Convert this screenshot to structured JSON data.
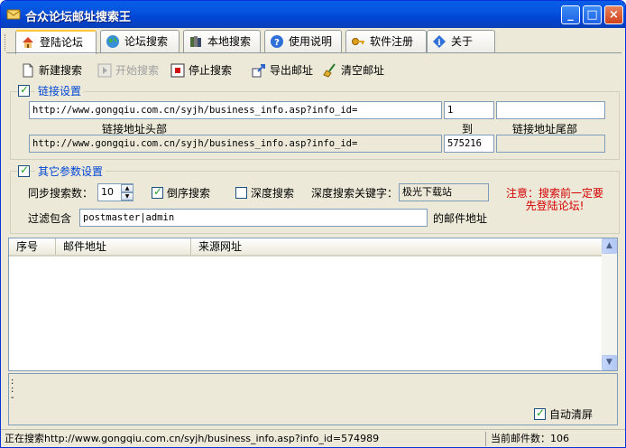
{
  "window": {
    "title": "合众论坛邮址搜索王",
    "controls": {
      "minimize": "_",
      "maximize": "□",
      "close": "×"
    }
  },
  "tabs": [
    {
      "label": "登陆论坛",
      "icon": "house-icon",
      "active": true
    },
    {
      "label": "论坛搜索",
      "icon": "globe-icon",
      "active": false
    },
    {
      "label": "本地搜索",
      "icon": "books-icon",
      "active": false
    },
    {
      "label": "使用说明",
      "icon": "help-icon",
      "active": false
    },
    {
      "label": "软件注册",
      "icon": "key-icon",
      "active": false
    },
    {
      "label": "关于",
      "icon": "info-icon",
      "active": false
    }
  ],
  "toolbar": {
    "new_search": "新建搜索",
    "start_search": "开始搜索",
    "stop_search": "停止搜索",
    "export_email": "导出邮址",
    "clear_email": "清空邮址"
  },
  "link_settings": {
    "title": "链接设置",
    "enabled": true,
    "url_head": "http://www.gongqiu.com.cn/syjh/business_info.asp?info_id=",
    "start_num": "1",
    "url_tail": "",
    "label_head": "链接地址头部",
    "label_to": "到",
    "label_tail": "链接地址尾部",
    "current_url_head": "http://www.gongqiu.com.cn/syjh/business_info.asp?info_id=",
    "end_num": "575216",
    "current_url_tail": ""
  },
  "other_settings": {
    "title": "其它参数设置",
    "enabled": true,
    "sync_label": "同步搜索数：",
    "sync_value": "10",
    "reverse_label": "倒序搜索",
    "reverse_checked": true,
    "deep_label": "深度搜索",
    "deep_checked": false,
    "keyword_label": "深度搜索关键字：",
    "keyword_value": "极光下载站",
    "notice_line1": "注意：搜索前一定要",
    "notice_line2": "先登陆论坛!",
    "filter_label": "过滤包含",
    "filter_value": "postmaster|admin",
    "filter_suffix": "的邮件地址"
  },
  "table": {
    "columns": [
      "序号",
      "邮件地址",
      "来源网址"
    ],
    "rows": []
  },
  "log": {
    "lines": [
      ":",
      ":",
      "-"
    ],
    "auto_clear_label": "自动清屏",
    "auto_clear_checked": true
  },
  "status": {
    "searching": "正在搜索http://www.gongqiu.com.cn/syjh/business_info.asp?info_id=574989",
    "count": "当前邮件数：106"
  }
}
